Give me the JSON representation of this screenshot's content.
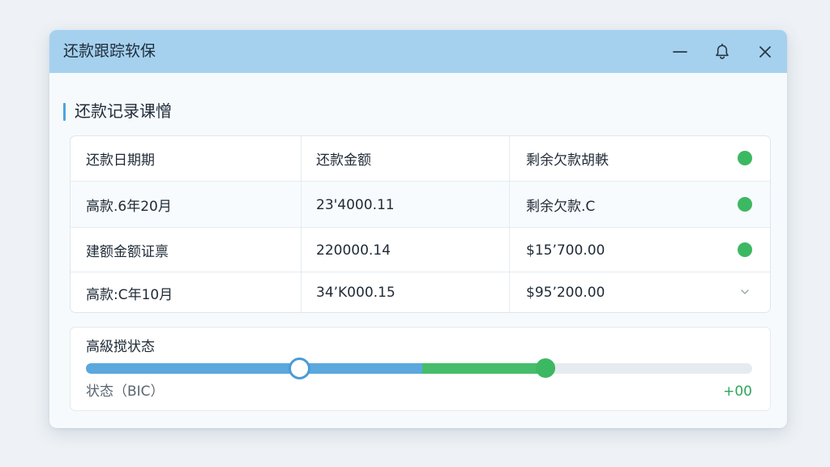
{
  "window": {
    "title": "还款跟踪软保"
  },
  "titlebar_icons": {
    "minimize": "minimize-icon",
    "notifications": "bell-icon",
    "close": "close-icon"
  },
  "section": {
    "title": "还款记录课憎"
  },
  "table": {
    "headers": [
      "还款日期期",
      "还款金额",
      "剩余欠款胡軼"
    ],
    "rows": [
      {
        "date": "高款.6年20月",
        "amount": "23'4000.11",
        "remaining": "剩余欠款.C",
        "indicator": "status-dot"
      },
      {
        "date": "建额金额证禀",
        "amount": "220000.14",
        "remaining": "$15ʼ700.00",
        "indicator": "status-dot"
      },
      {
        "date": "高款:C年10月",
        "amount": "34ʼK000.15",
        "remaining": "$95ʼ200.00",
        "indicator": "chevron-down-icon"
      }
    ]
  },
  "status": {
    "label": "高級搅状态",
    "sublabel": "状态（BIC）",
    "value": "+00",
    "blue_progress": 0.32,
    "green_progress": 0.69
  },
  "colors": {
    "titlebar": "#a5d1ef",
    "accent_blue": "#5aa8de",
    "accent_green": "#3cb862"
  }
}
